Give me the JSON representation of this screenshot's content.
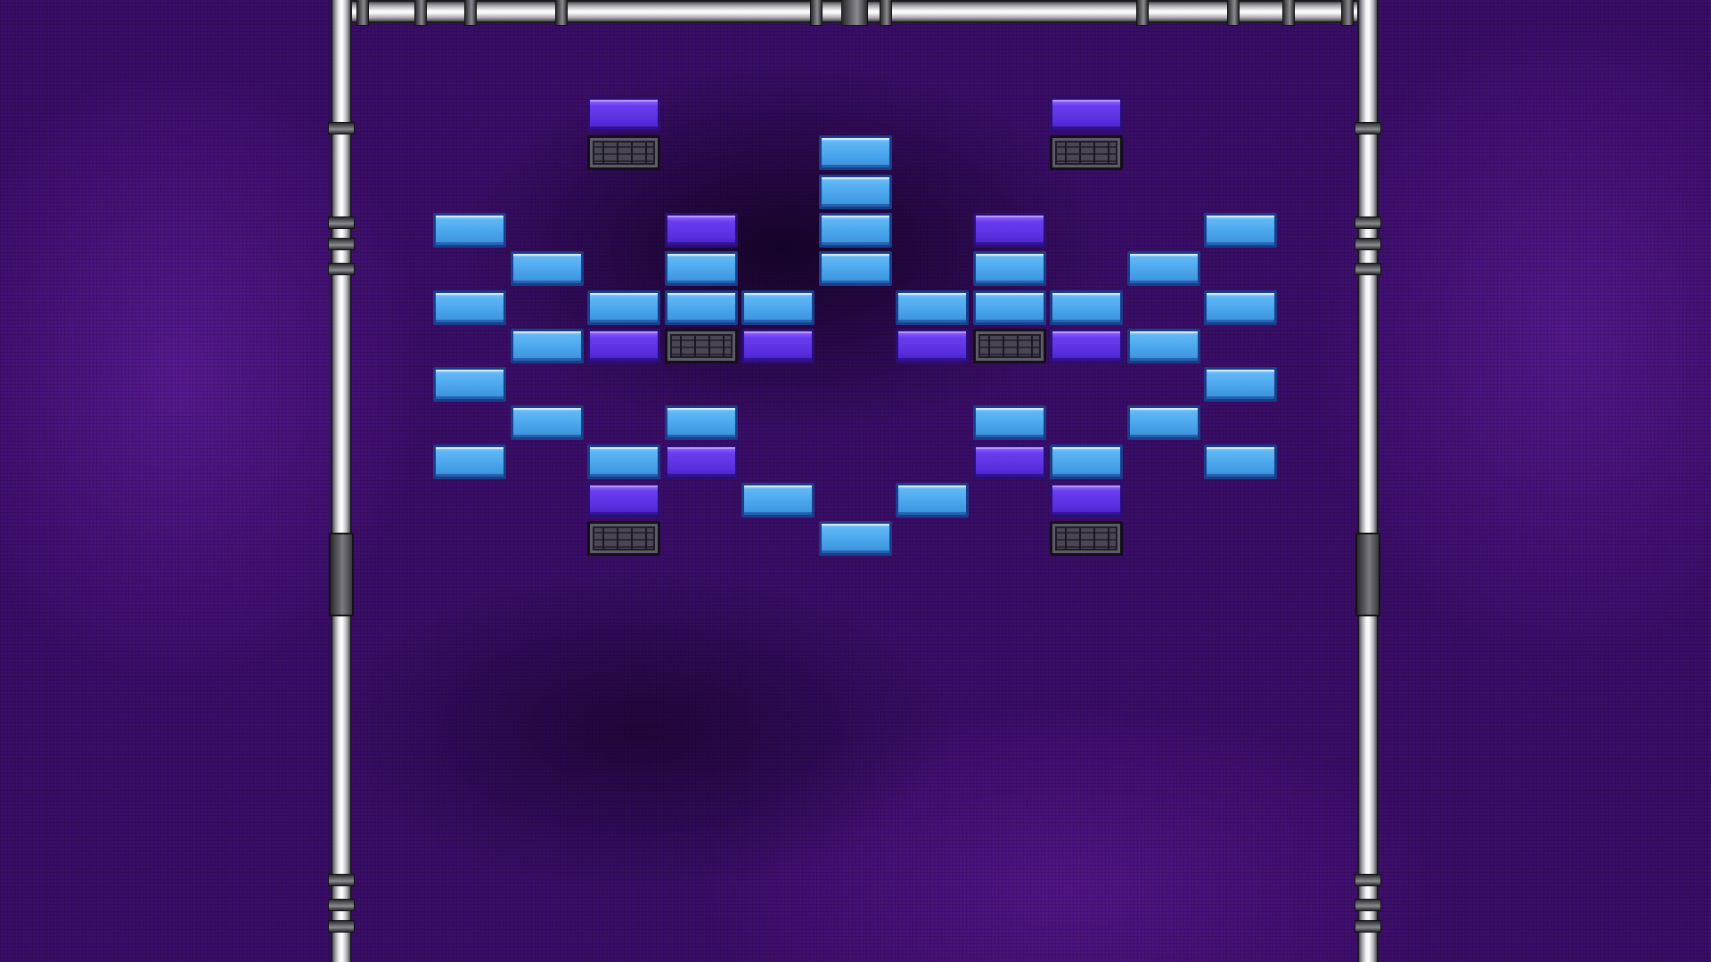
{
  "game": {
    "type": "brick-breaker",
    "brick_colors": {
      "blue": "#4aa6ec",
      "purple": "#5a2fe0",
      "steel": "#3a3644"
    },
    "background_color": "#3a0d68",
    "frame_color": "#e8e8ec",
    "bricks": [
      {
        "type": "purple",
        "col": 4,
        "row": 0
      },
      {
        "type": "steel",
        "col": 4,
        "row": 1
      },
      {
        "type": "purple",
        "col": 10,
        "row": 0
      },
      {
        "type": "steel",
        "col": 10,
        "row": 1
      },
      {
        "type": "blue",
        "col": 7,
        "row": 1
      },
      {
        "type": "blue",
        "col": 7,
        "row": 2
      },
      {
        "type": "blue",
        "col": 7,
        "row": 3
      },
      {
        "type": "blue",
        "col": 7,
        "row": 4
      },
      {
        "type": "blue",
        "col": 2,
        "row": 3
      },
      {
        "type": "purple",
        "col": 5,
        "row": 3
      },
      {
        "type": "purple",
        "col": 9,
        "row": 3
      },
      {
        "type": "blue",
        "col": 12,
        "row": 3
      },
      {
        "type": "blue",
        "col": 3,
        "row": 4
      },
      {
        "type": "blue",
        "col": 5,
        "row": 4
      },
      {
        "type": "blue",
        "col": 9,
        "row": 4
      },
      {
        "type": "blue",
        "col": 11,
        "row": 4
      },
      {
        "type": "blue",
        "col": 2,
        "row": 5
      },
      {
        "type": "blue",
        "col": 4,
        "row": 5
      },
      {
        "type": "blue",
        "col": 5,
        "row": 5
      },
      {
        "type": "blue",
        "col": 6,
        "row": 5
      },
      {
        "type": "blue",
        "col": 8,
        "row": 5
      },
      {
        "type": "blue",
        "col": 9,
        "row": 5
      },
      {
        "type": "blue",
        "col": 10,
        "row": 5
      },
      {
        "type": "blue",
        "col": 12,
        "row": 5
      },
      {
        "type": "blue",
        "col": 3,
        "row": 6
      },
      {
        "type": "purple",
        "col": 4,
        "row": 6
      },
      {
        "type": "steel",
        "col": 5,
        "row": 6
      },
      {
        "type": "purple",
        "col": 6,
        "row": 6
      },
      {
        "type": "purple",
        "col": 8,
        "row": 6
      },
      {
        "type": "steel",
        "col": 9,
        "row": 6
      },
      {
        "type": "purple",
        "col": 10,
        "row": 6
      },
      {
        "type": "blue",
        "col": 11,
        "row": 6
      },
      {
        "type": "blue",
        "col": 2,
        "row": 7
      },
      {
        "type": "blue",
        "col": 12,
        "row": 7
      },
      {
        "type": "blue",
        "col": 3,
        "row": 8
      },
      {
        "type": "blue",
        "col": 5,
        "row": 8
      },
      {
        "type": "blue",
        "col": 9,
        "row": 8
      },
      {
        "type": "blue",
        "col": 11,
        "row": 8
      },
      {
        "type": "blue",
        "col": 2,
        "row": 9
      },
      {
        "type": "blue",
        "col": 4,
        "row": 9
      },
      {
        "type": "purple",
        "col": 5,
        "row": 9
      },
      {
        "type": "purple",
        "col": 9,
        "row": 9
      },
      {
        "type": "blue",
        "col": 10,
        "row": 9
      },
      {
        "type": "blue",
        "col": 12,
        "row": 9
      },
      {
        "type": "purple",
        "col": 4,
        "row": 10
      },
      {
        "type": "blue",
        "col": 6,
        "row": 10
      },
      {
        "type": "blue",
        "col": 8,
        "row": 10
      },
      {
        "type": "purple",
        "col": 10,
        "row": 10
      },
      {
        "type": "steel",
        "col": 4,
        "row": 11
      },
      {
        "type": "blue",
        "col": 7,
        "row": 11
      },
      {
        "type": "steel",
        "col": 10,
        "row": 11
      }
    ]
  }
}
